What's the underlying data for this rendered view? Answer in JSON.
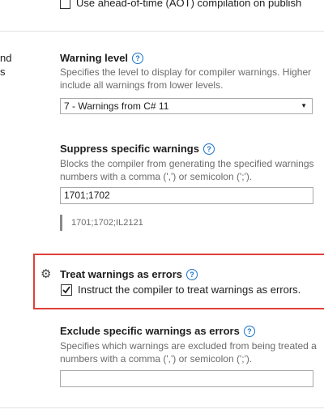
{
  "top_option": {
    "label": "Use ahead-of-time (AOT) compilation on publish"
  },
  "left_fragments": {
    "line1": "nd",
    "line2": "s"
  },
  "warning_level": {
    "title": "Warning level",
    "desc_line1": "Specifies the level to display for compiler warnings. Higher",
    "desc_line2": "include all warnings from lower levels.",
    "selected": "7 - Warnings from C# 11"
  },
  "suppress": {
    "title": "Suppress specific warnings",
    "desc_line1": "Blocks the compiler from generating the specified warnings",
    "desc_line2": "numbers with a comma (',') or semicolon (';').",
    "value": "1701;1702",
    "effective_value": "1701;1702;IL2121"
  },
  "treat_errors": {
    "title": "Treat warnings as errors",
    "checkbox_label": "Instruct the compiler to treat warnings as errors.",
    "checked": true
  },
  "exclude": {
    "title": "Exclude specific warnings as errors",
    "desc_line1": "Specifies which warnings are excluded from being treated a",
    "desc_line2": "numbers with a comma (',') or semicolon (';').",
    "value": ""
  },
  "colors": {
    "accent": "#1a73c7",
    "highlight_border": "#e0403a"
  }
}
